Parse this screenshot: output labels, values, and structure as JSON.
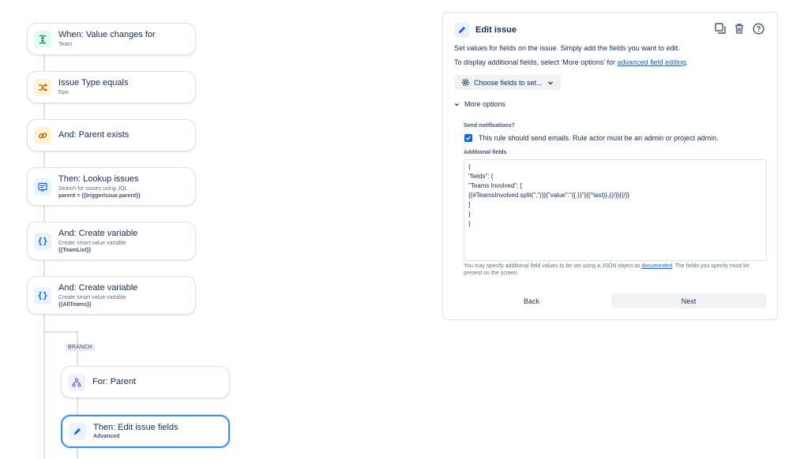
{
  "rules": [
    {
      "title": "When: Value changes for",
      "sub": "Team",
      "icon": "value-change-icon"
    },
    {
      "title": "Issue Type equals",
      "sub": "Epic",
      "icon": "shuffle-icon"
    },
    {
      "title": "And: Parent exists",
      "icon": "link-icon"
    },
    {
      "title": "Then: Lookup issues",
      "sub": "Search for issues using JQL",
      "sub2": "parent = {{triggerIssue.parent}}",
      "icon": "lookup-icon"
    },
    {
      "title": "And: Create variable",
      "sub": "Create smart value variable",
      "sub2": "{{TeamList}}",
      "icon": "braces-icon"
    },
    {
      "title": "And: Create variable",
      "sub": "Create smart value variable",
      "sub2": "{{AllTeams}}",
      "icon": "braces-icon"
    },
    {
      "title": "For: Parent",
      "icon": "hierarchy-icon"
    },
    {
      "title": "Then: Edit issue fields",
      "sub2": "Advanced",
      "icon": "pencil-icon"
    }
  ],
  "branch_label": "BRANCH",
  "panel": {
    "title": "Edit issue",
    "desc1": "Set values for fields on the issue. Simply add the fields you want to edit.",
    "desc2_prefix": "To display additional fields, select 'More options' for ",
    "desc2_link": "advanced field editing",
    "desc2_suffix": ".",
    "choose_label": "Choose fields to set...",
    "more_options": "More options",
    "send_notifications_label": "Send notifications?",
    "notify_text": "This rule should send emails. Rule actor must be an admin or project admin.",
    "additional_fields_label": "Additional fields",
    "json_lines": [
      "{",
      "\"fields\": {",
      "\"Teams Involved\": [",
      "{{#TeamsInvolved.split(\",\")}}{\"value\":\"{{.}}\"}{{^last}},{{/}}{{/}}",
      "]",
      "}",
      "}"
    ],
    "help_prefix": "You may specify additional field values to be set using a JSON object as ",
    "help_link": "documented",
    "help_suffix": ". The fields you specify must be present on the screen.",
    "back_label": "Back",
    "next_label": "Next"
  },
  "colors": {
    "accent": "#0c66e4",
    "selected_border": "#388bff"
  }
}
